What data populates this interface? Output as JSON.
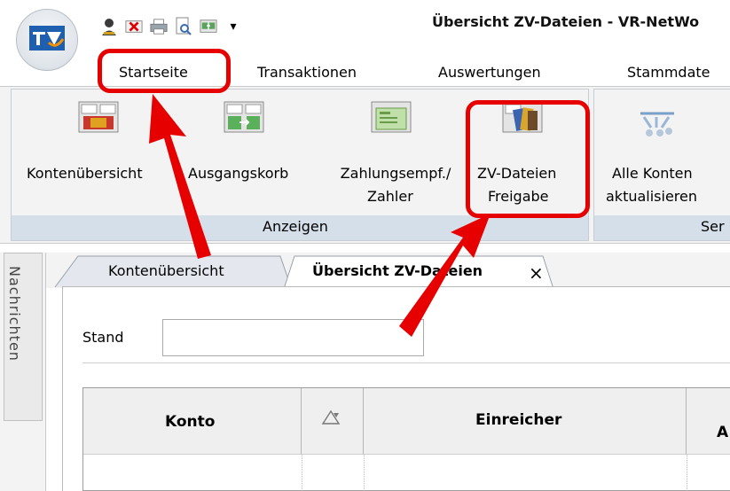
{
  "window": {
    "title": "Übersicht ZV-Dateien - VR-NetWo"
  },
  "quick_access": [
    {
      "icon": "user-icon"
    },
    {
      "icon": "delete-icon"
    },
    {
      "icon": "print-icon"
    },
    {
      "icon": "print-preview-icon"
    },
    {
      "icon": "transfer-icon"
    },
    {
      "icon": "customize-dropdown-icon",
      "glyph": "▾"
    }
  ],
  "ribbon_tabs": [
    "Startseite",
    "Transaktionen",
    "Auswertungen",
    "Stammdate"
  ],
  "ribbon": {
    "group_anzeigen": {
      "label": "Anzeigen",
      "buttons": [
        {
          "line1": "Kontenübersicht",
          "line2": "",
          "icon": "accounts-overview-icon"
        },
        {
          "line1": "Ausgangskorb",
          "line2": "",
          "icon": "outbox-icon"
        },
        {
          "line1": "Zahlungsempf./",
          "line2": "Zahler",
          "icon": "payee-icon"
        },
        {
          "line1": "ZV-Dateien",
          "line2": "Freigabe",
          "icon": "payment-files-release-icon"
        }
      ]
    },
    "group_service": {
      "label": "Ser",
      "buttons": [
        {
          "line1": "Alle Konten",
          "line2": "aktualisieren",
          "icon": "refresh-all-accounts-icon"
        }
      ]
    }
  },
  "side_nav": {
    "label": "Nachrichten"
  },
  "doc_tabs": [
    {
      "label": "Kontenübersicht",
      "active": false
    },
    {
      "label": "Übersicht ZV-Dateien",
      "active": true,
      "close": "×"
    }
  ],
  "form": {
    "stand_label": "Stand",
    "stand_value": ""
  },
  "grid": {
    "columns": [
      "Konto",
      "",
      "Einreicher",
      "A"
    ],
    "sort_icon": "sort-icon"
  },
  "colors": {
    "highlight": "#e60000",
    "ribbon_group_label_bg": "#d5dfea",
    "brand_blue": "#1f5fb0"
  }
}
